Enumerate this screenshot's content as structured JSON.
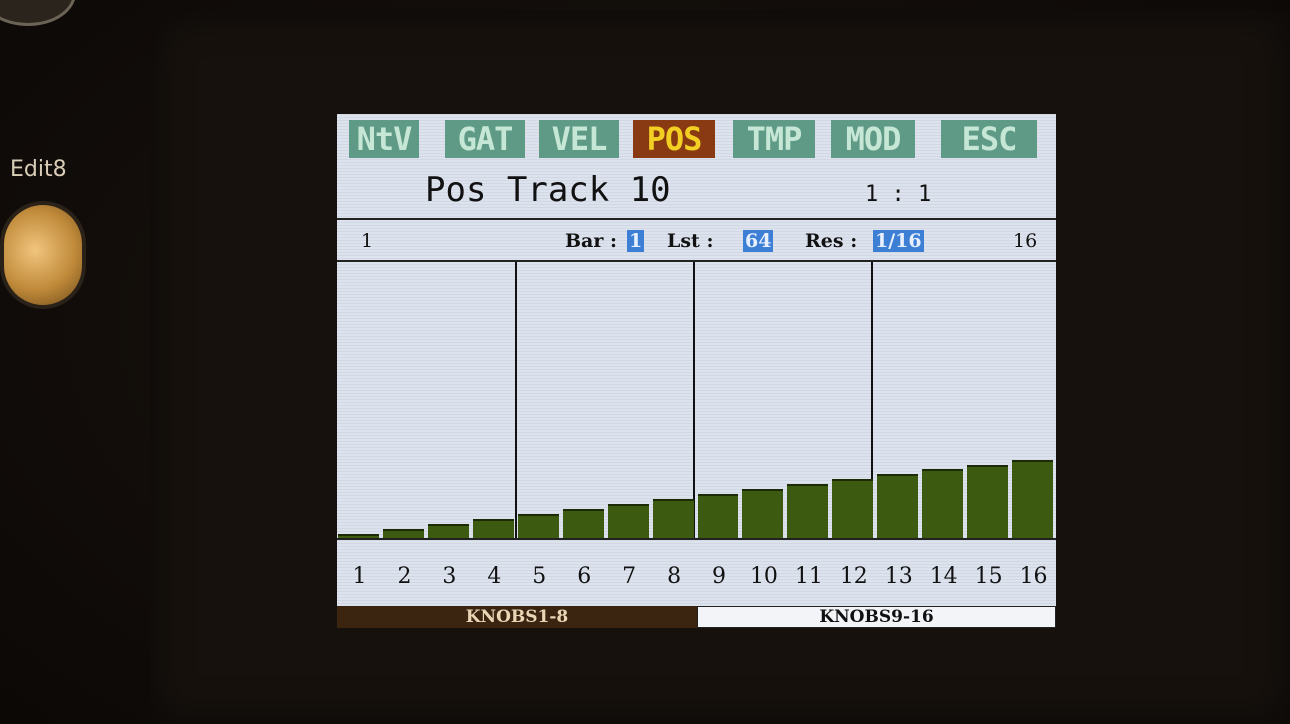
{
  "device": {
    "side_label": "Edit8"
  },
  "tabs": [
    {
      "label": "NtV",
      "active": false
    },
    {
      "label": "GAT",
      "active": false
    },
    {
      "label": "VEL",
      "active": false
    },
    {
      "label": "POS",
      "active": true
    },
    {
      "label": "TMP",
      "active": false
    },
    {
      "label": "MOD",
      "active": false
    },
    {
      "label": "ESC",
      "active": false
    }
  ],
  "header": {
    "title": "Pos Track 10",
    "position": "1 :  1"
  },
  "info": {
    "range_start": "1",
    "bar_label": "Bar :",
    "bar_value": "1",
    "last_label": "Lst :",
    "last_value": "64",
    "res_label": "Res :",
    "res_value": "1/16",
    "range_end": "16"
  },
  "steps": {
    "labels": [
      "1",
      "2",
      "3",
      "4",
      "5",
      "6",
      "7",
      "8",
      "9",
      "10",
      "11",
      "12",
      "13",
      "14",
      "15",
      "16"
    ],
    "values": [
      0.5,
      1.5,
      2.5,
      3.5,
      4.5,
      5.5,
      6.5,
      7.5,
      8.5,
      9.5,
      10.5,
      11.5,
      12.5,
      13.5,
      14.5,
      15.5
    ]
  },
  "footer": {
    "left": "KNOBS1-8",
    "right": "KNOBS9-16"
  },
  "colors": {
    "screen_bg": "#dde3ee",
    "tab_inactive": "#5f9a87",
    "tab_active_bg": "#8a3a12",
    "tab_active_text": "#f3cf24",
    "bar": "#3c5a10",
    "highlight": "#3e7fd6"
  }
}
